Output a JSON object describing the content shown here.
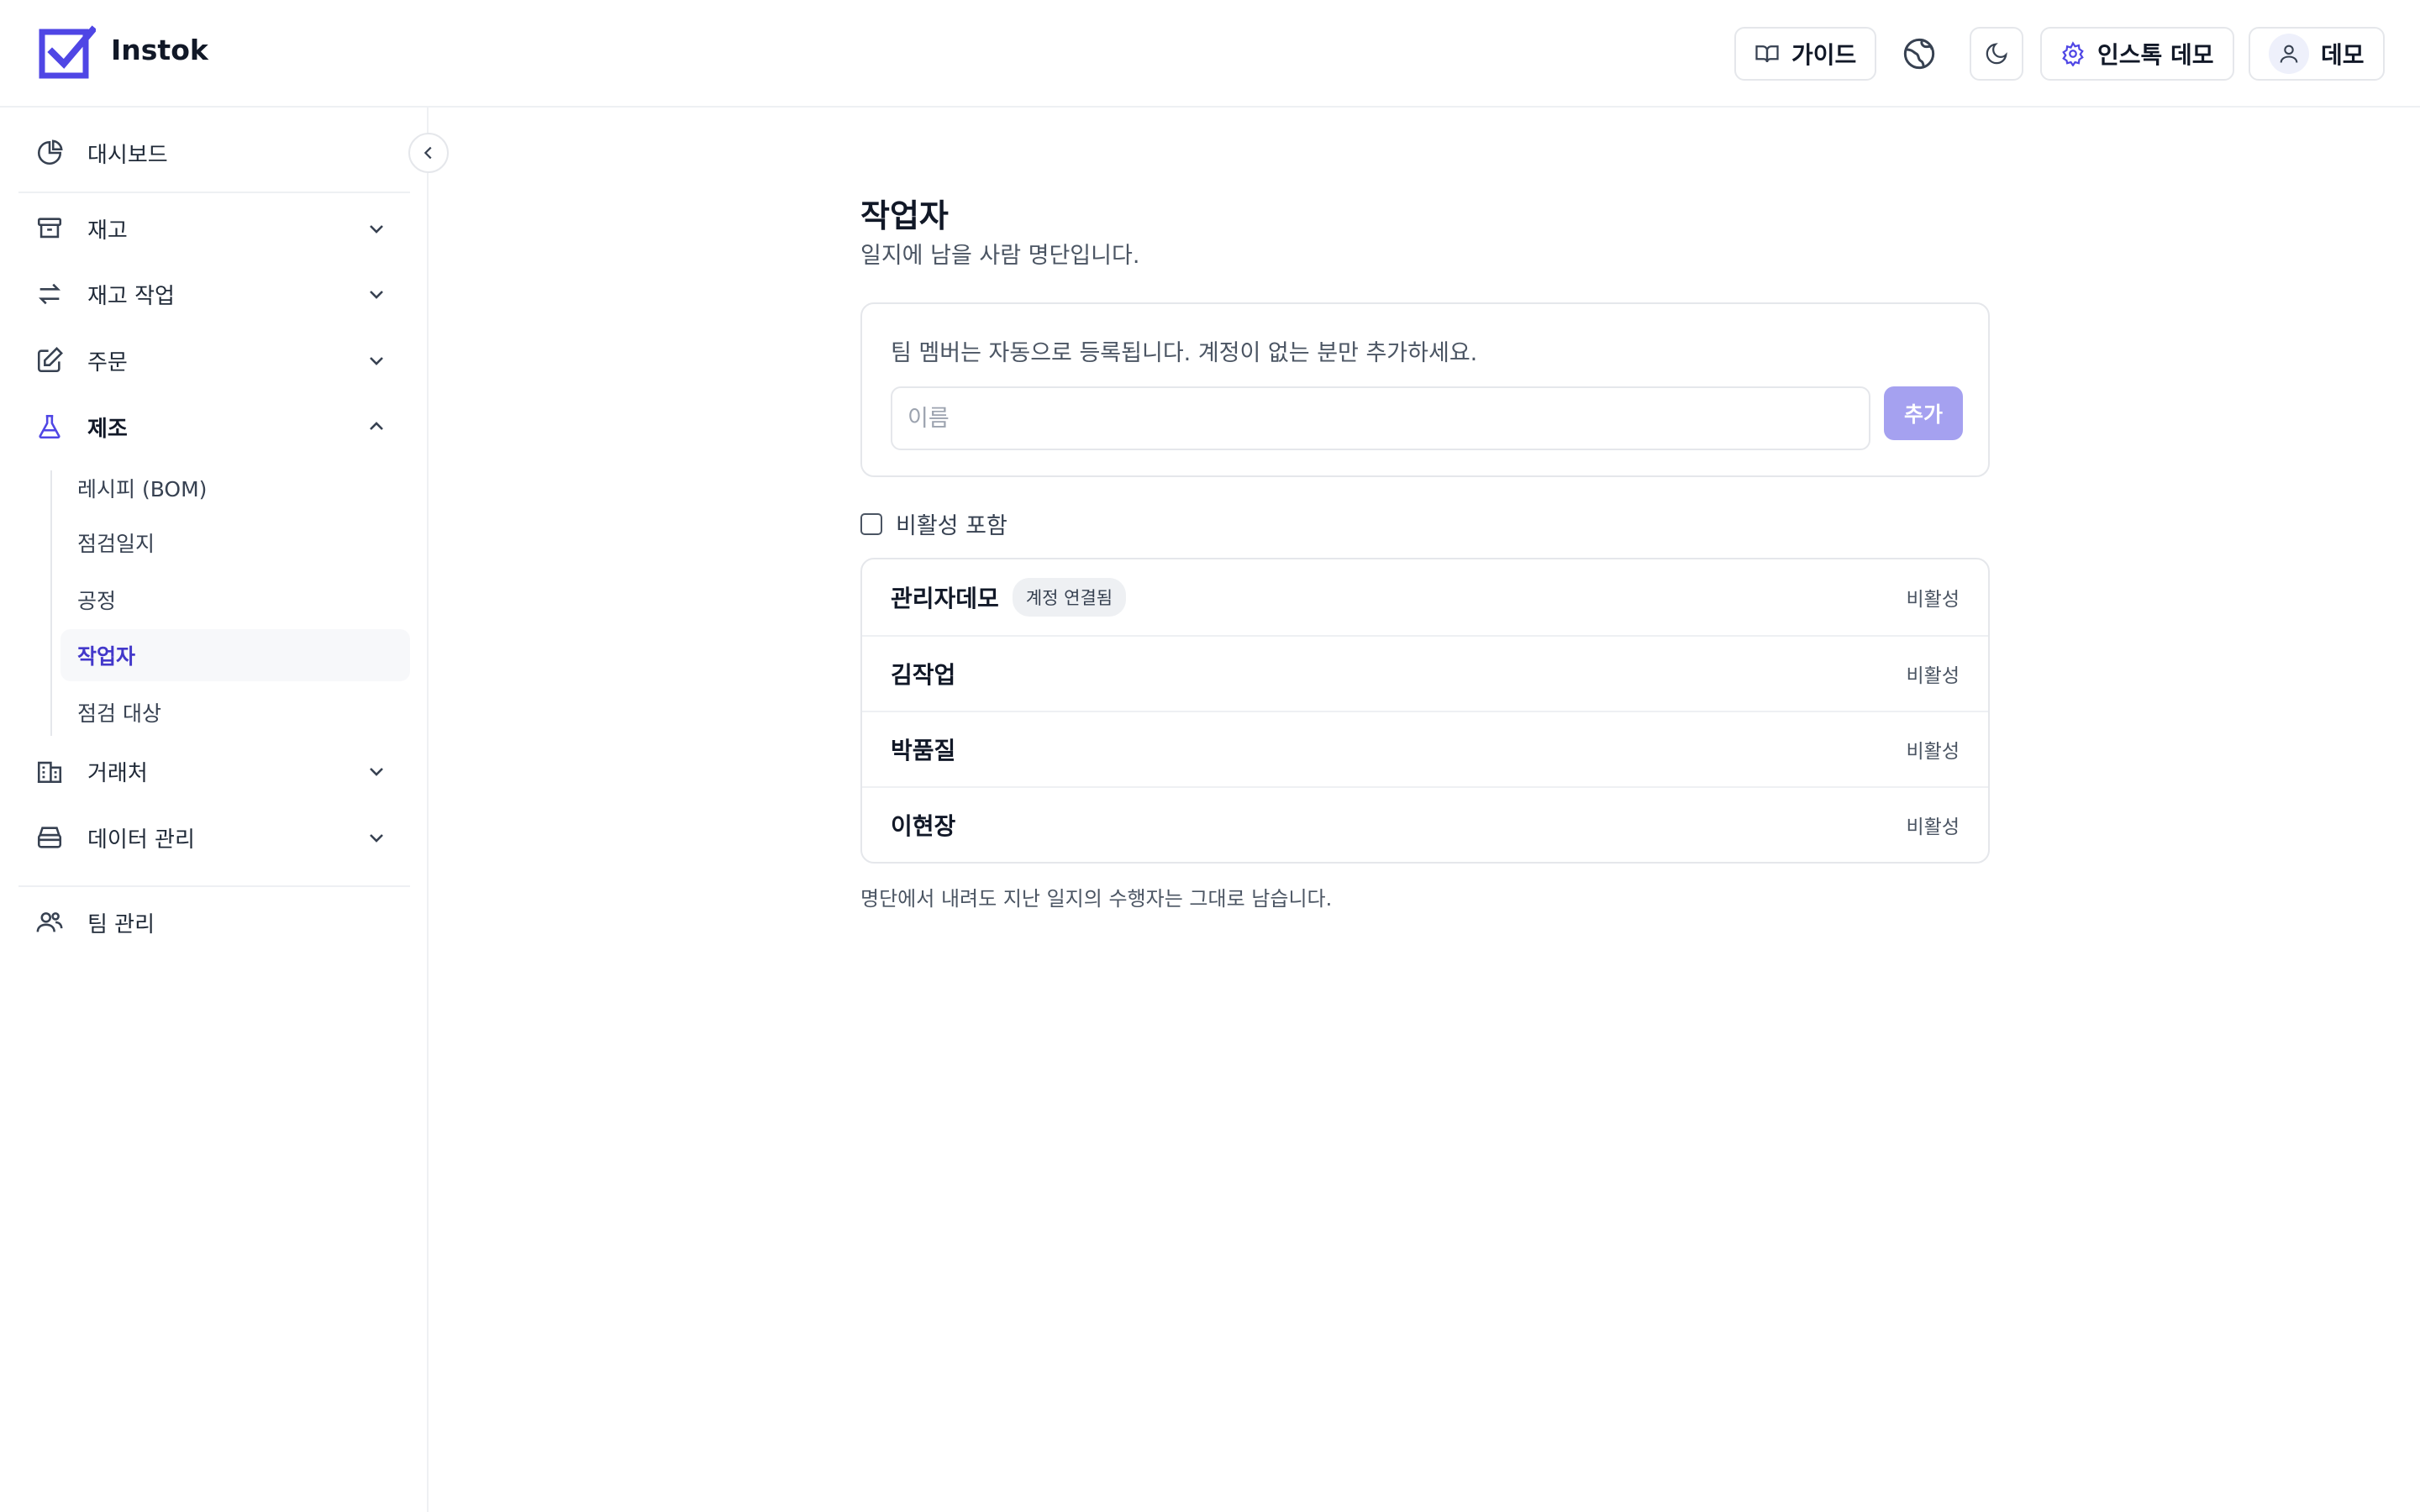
{
  "header": {
    "brand": "Instok",
    "guide_label": "가이드",
    "org_label": "인스톡 데모",
    "user_label": "데모",
    "icons": {
      "guide": "book-open-icon",
      "language": "globe-icon",
      "theme": "moon-icon",
      "org": "gear-icon",
      "user": "user-icon"
    },
    "accent": "#4f46e5"
  },
  "sidebar": {
    "dashboard": "대시보드",
    "groups": [
      {
        "label": "재고",
        "icon": "archive-icon"
      },
      {
        "label": "재고 작업",
        "icon": "arrows-exchange-icon"
      },
      {
        "label": "주문",
        "icon": "edit-icon"
      },
      {
        "label": "제조",
        "icon": "flask-icon"
      },
      {
        "label": "거래처",
        "icon": "building-icon"
      },
      {
        "label": "데이터 관리",
        "icon": "database-icon"
      }
    ],
    "sub_items": [
      "레시피 (BOM)",
      "점검일지",
      "공정",
      "작업자",
      "점검 대상"
    ],
    "active_sub_item": "작업자",
    "team": "팀 관리"
  },
  "main": {
    "title": "작업자",
    "subtitle": "일지에 남을 사람 명단입니다.",
    "add_hint": "팀 멤버는 자동으로 등록됩니다. 계정이 없는 분만 추가하세요.",
    "name_placeholder": "이름",
    "add_button": "추가",
    "include_inactive": "비활성 포함",
    "workers": [
      {
        "name": "관리자데모",
        "badge": "계정 연결됨",
        "action": "비활성"
      },
      {
        "name": "김작업",
        "action": "비활성"
      },
      {
        "name": "박품질",
        "action": "비활성"
      },
      {
        "name": "이현장",
        "action": "비활성"
      }
    ],
    "footnote": "명단에서 내려도 지난 일지의 수행자는 그대로 남습니다."
  }
}
